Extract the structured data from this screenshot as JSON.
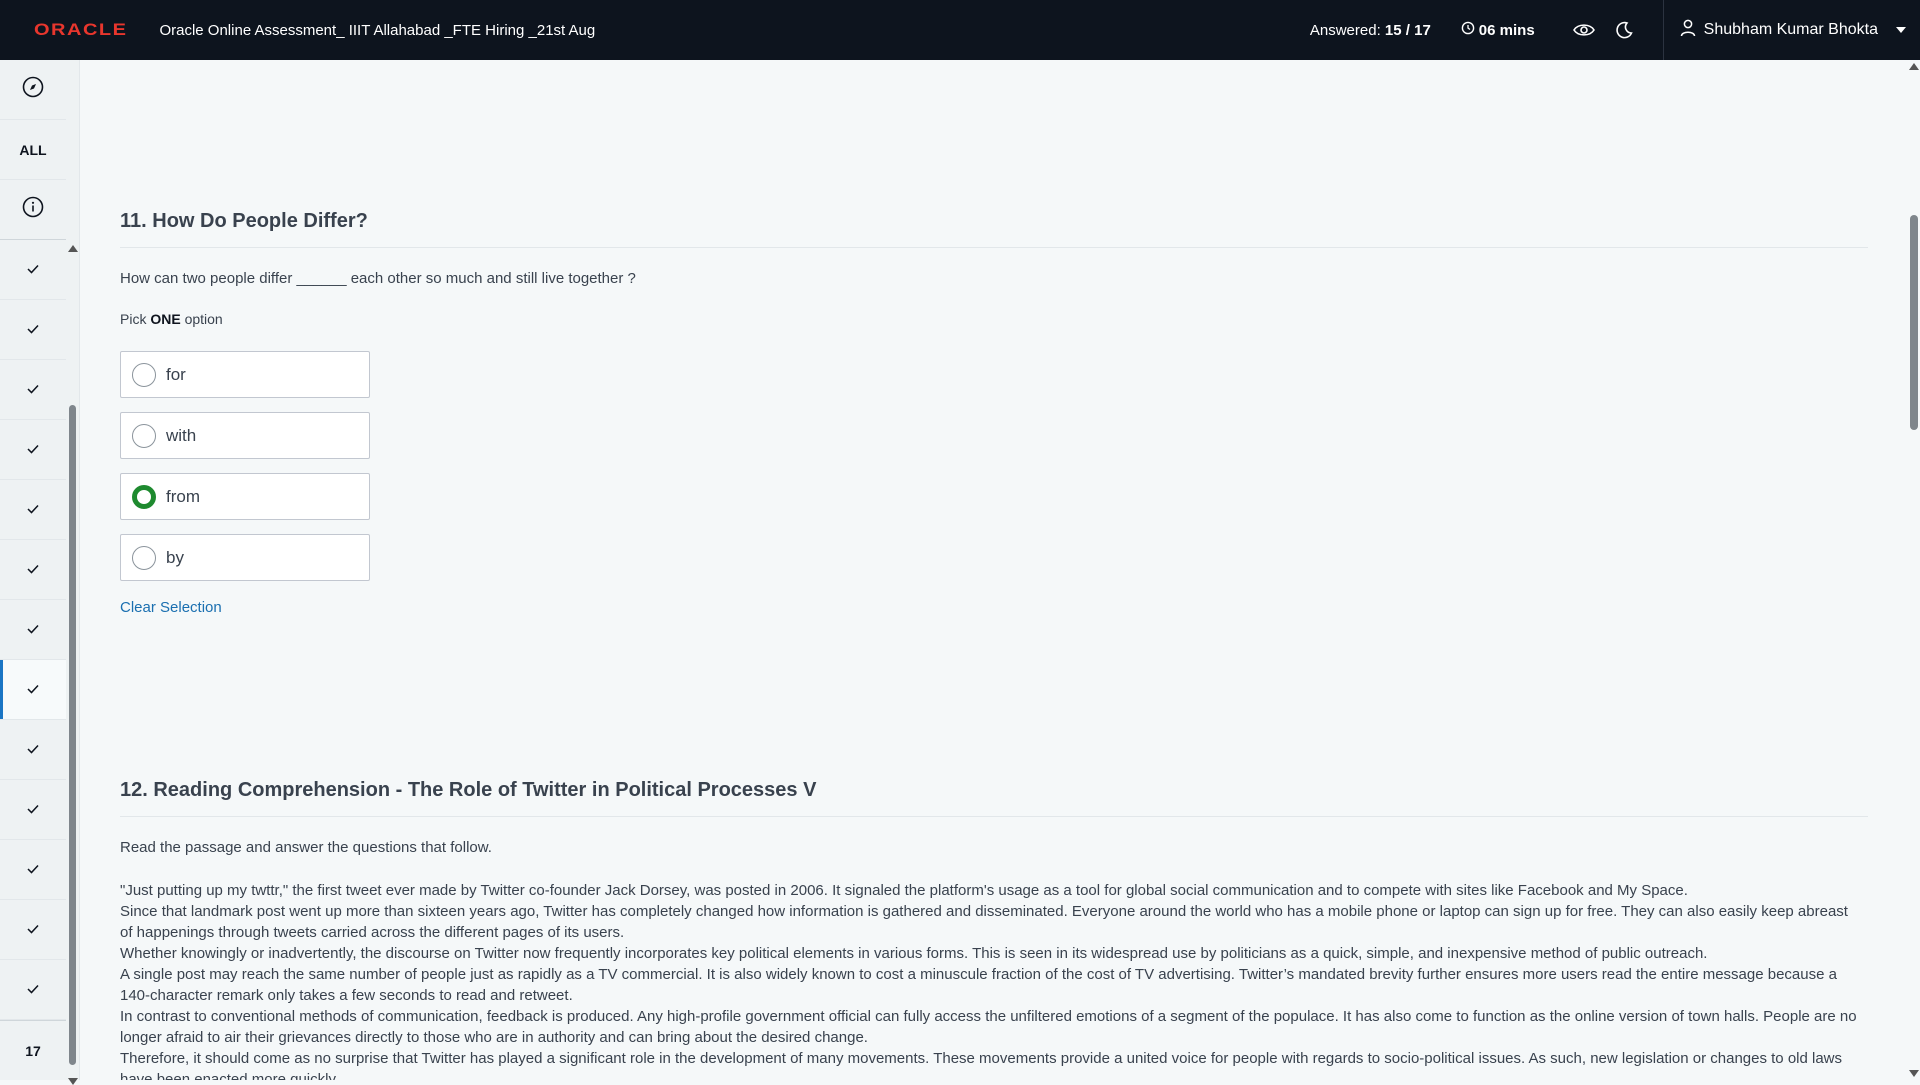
{
  "header": {
    "logo": "ORACLE",
    "test_title": "Oracle Online Assessment_ IIIT Allahabad _FTE Hiring _21st Aug",
    "answered_label": "Answered:",
    "answered_value": "15 / 17",
    "timer": "06 mins",
    "user_name": "Shubham Kumar Bhokta",
    "icons": [
      "eye-icon",
      "moon-icon",
      "user-icon",
      "chevron-down-icon",
      "clock-icon"
    ]
  },
  "sidebar": {
    "all_label": "ALL",
    "question_count": "17",
    "items": [
      {
        "status": "answered"
      },
      {
        "status": "answered"
      },
      {
        "status": "answered"
      },
      {
        "status": "answered"
      },
      {
        "status": "answered"
      },
      {
        "status": "answered"
      },
      {
        "status": "answered"
      },
      {
        "status": "answered",
        "active": true
      },
      {
        "status": "answered"
      },
      {
        "status": "answered"
      },
      {
        "status": "answered"
      },
      {
        "status": "answered"
      },
      {
        "status": "answered"
      }
    ]
  },
  "question11": {
    "title": "11. How Do People Differ?",
    "text": "How can two people differ ______ each other so much and still live together ?",
    "pick_prefix": "Pick ",
    "pick_bold": "ONE",
    "pick_suffix": " option",
    "options": [
      "for",
      "with",
      "from",
      "by"
    ],
    "selected": "from",
    "clear_label": "Clear Selection"
  },
  "question12": {
    "title": "12. Reading Comprehension - The Role of Twitter in Political Processes V",
    "intro": "Read the passage and answer the questions that follow.",
    "paragraphs": [
      "\"Just putting up my twttr,\" the first tweet ever made by Twitter co-founder Jack Dorsey, was posted in 2006. It signaled the platform's usage as a tool for global social communication and to compete with sites like Facebook and My Space.",
      "Since that landmark post went up more than sixteen years ago, Twitter has completely changed how information is gathered and disseminated. Everyone around the world who has a mobile phone or laptop can sign up for free. They can also easily keep abreast of happenings through tweets carried across the different pages of its users.",
      "Whether knowingly or inadvertently, the discourse on Twitter now frequently incorporates key political elements in various forms. This is seen in its widespread use by politicians as a quick, simple, and inexpensive method of public outreach.",
      "A single post may reach the same number of people just as rapidly as a TV commercial. It is also widely known to cost a minuscule fraction of the cost of TV advertising. Twitter’s mandated brevity further ensures more users read the entire message because a 140-character remark only takes a few seconds to read and retweet.",
      "In contrast to conventional methods of communication, feedback is produced. Any high-profile government official can fully access the unfiltered emotions of a segment of the populace. It has also come to function as the online version of town halls. People are no longer afraid to air their grievances directly to those who are in authority and can bring about the desired change.",
      "Therefore, it should come as no surprise that Twitter has played a significant role in the development of many movements. These movements provide a united voice for people with regards to socio-political issues. As such, new legislation or changes to old laws have been enacted more quickly."
    ]
  },
  "colors": {
    "topbar": "#0d141e",
    "brand": "#e8362d",
    "selected_radio": "#1e8a2f",
    "link": "#1a6fb0",
    "active_indicator": "#1a75c4"
  }
}
